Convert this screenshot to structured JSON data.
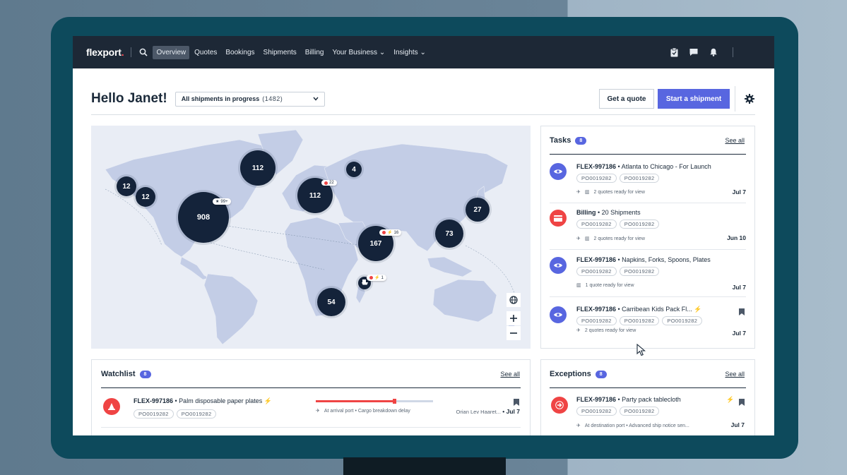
{
  "nav": {
    "logo": "flexport",
    "logo_dot": ".",
    "items": [
      "Overview",
      "Quotes",
      "Bookings",
      "Shipments",
      "Billing",
      "Your Business",
      "Insights"
    ],
    "dropdown_suffix": "⌄"
  },
  "header": {
    "greeting": "Hello Janet!",
    "filter_label": "All shipments in progress",
    "filter_count": "(1482)",
    "get_quote": "Get a quote",
    "start_shipment": "Start a shipment"
  },
  "map": {
    "bubbles": [
      "12",
      "12",
      "908",
      "112",
      "112",
      "4",
      "167",
      "73",
      "27",
      "54"
    ],
    "pills": [
      "99+",
      "22",
      "16",
      "1"
    ]
  },
  "tasks": {
    "title": "Tasks",
    "count": "8",
    "see_all": "See all",
    "items": [
      {
        "id": "FLEX-997186",
        "desc": " • Atlanta to Chicago - For Launch",
        "tags": [
          "PO0019282",
          "PO0019282"
        ],
        "sub": "2 quotes ready for view",
        "date": "Jul 7"
      },
      {
        "id": "Billing",
        "desc": " • 20 Shipments",
        "tags": [
          "PO0019282",
          "PO0019282"
        ],
        "sub": "2 quotes ready for view",
        "date": "Jun 10"
      },
      {
        "id": "FLEX-997186",
        "desc": " • Napkins, Forks, Spoons, Plates",
        "tags": [
          "PO0019282",
          "PO0019282"
        ],
        "sub": "1 quote ready for view",
        "date": "Jul 7"
      },
      {
        "id": "FLEX-997186",
        "desc": " • Carribean Kids Pack Fl...",
        "tags": [
          "PO0019282",
          "PO0019282",
          "PO0019282"
        ],
        "sub": "2 quotes ready for view",
        "date": "Jul 7"
      }
    ]
  },
  "watchlist": {
    "title": "Watchlist",
    "count": "8",
    "see_all": "See all",
    "item": {
      "id": "FLEX-997186",
      "desc": " • Palm disposable paper plates",
      "tags": [
        "PO0019282",
        "PO0019282"
      ],
      "status": "At arrival port • Cargo breakdown delay",
      "assignee": "Orian Lev Haaret...",
      "date": " • Jul 7",
      "progress": 0.67
    }
  },
  "exceptions": {
    "title": "Exceptions",
    "count": "8",
    "see_all": "See all",
    "item": {
      "id": "FLEX-997186",
      "desc": " • Party pack tablecloth",
      "tags": [
        "PO0019282",
        "PO0019282"
      ],
      "status": "At destination port • Advanced ship notice sen...",
      "date": "Jul 7"
    }
  },
  "colors": {
    "primary": "#5866e0",
    "danger": "#ef4444",
    "nav_bg": "#1d2836",
    "bubble": "#14233a",
    "monitor": "#0d4a5c"
  }
}
